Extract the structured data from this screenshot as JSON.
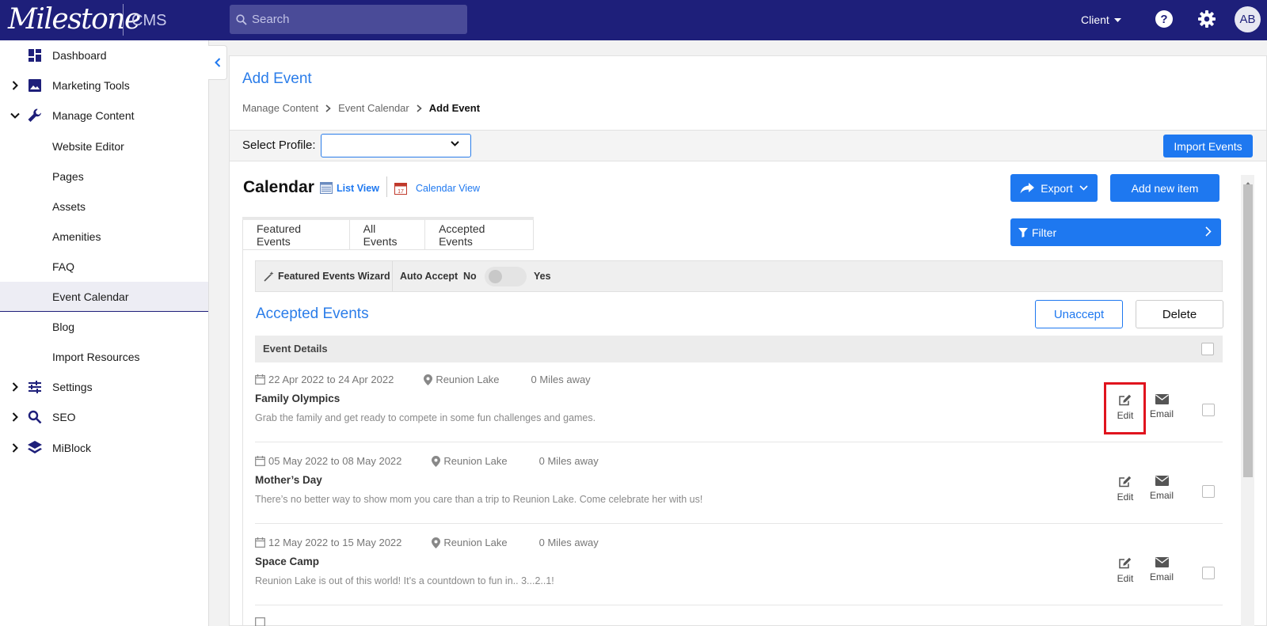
{
  "topbar": {
    "logo_text": "Milestone",
    "product": "CMS",
    "search_placeholder": "Search",
    "client_label": "Client",
    "avatar_initials": "AB",
    "brand_color": "#1e1f7a"
  },
  "sidebar": {
    "items": [
      {
        "label": "Dashboard",
        "icon": "dashboard-icon",
        "expandable": false
      },
      {
        "label": "Marketing Tools",
        "icon": "image-icon",
        "expandable": true
      },
      {
        "label": "Manage Content",
        "icon": "wrench-icon",
        "expandable": true,
        "expanded": true
      },
      {
        "label": "Website Editor"
      },
      {
        "label": "Pages"
      },
      {
        "label": "Assets"
      },
      {
        "label": "Amenities"
      },
      {
        "label": "FAQ"
      },
      {
        "label": "Event Calendar",
        "active": true
      },
      {
        "label": "Blog"
      },
      {
        "label": "Import Resources"
      },
      {
        "label": "Settings",
        "icon": "sliders-icon",
        "expandable": true
      },
      {
        "label": "SEO",
        "icon": "search-icon",
        "expandable": true
      },
      {
        "label": "MiBlock",
        "icon": "layers-icon",
        "expandable": true
      }
    ]
  },
  "page": {
    "title": "Add Event",
    "breadcrumb": [
      "Manage Content",
      "Event Calendar",
      "Add Event"
    ],
    "select_profile_label": "Select Profile:",
    "select_profile_value": "",
    "import_events_label": "Import Events"
  },
  "calendar": {
    "title": "Calendar",
    "list_view_label": "List View",
    "calendar_view_label": "Calendar View",
    "export_label": "Export",
    "add_new_label": "Add new item",
    "filter_label": "Filter",
    "tabs": [
      "Featured Events",
      "All Events",
      "Accepted Events"
    ],
    "wizard_label": "Featured Events Wizard",
    "auto_accept_label": "Auto Accept",
    "auto_accept_no": "No",
    "auto_accept_yes": "Yes",
    "auto_accept_on": false
  },
  "accepted": {
    "title": "Accepted Events",
    "unaccept_label": "Unaccept",
    "delete_label": "Delete",
    "details_header": "Event Details",
    "edit_label": "Edit",
    "email_label": "Email",
    "events": [
      {
        "dates": "22 Apr 2022 to 24 Apr 2022",
        "location": "Reunion Lake",
        "distance": "0 Miles away",
        "name": "Family Olympics",
        "desc": "Grab the family and get ready to compete in some fun challenges and games."
      },
      {
        "dates": "05 May 2022 to 08 May 2022",
        "location": "Reunion Lake",
        "distance": "0 Miles away",
        "name": "Mother’s Day",
        "desc": "There’s no better way to show mom you care than a trip to Reunion Lake. Come celebrate her with us!"
      },
      {
        "dates": "12 May 2022 to 15 May 2022",
        "location": "Reunion Lake",
        "distance": "0 Miles away",
        "name": "Space Camp",
        "desc": "Reunion Lake is out of this world! It’s a countdown to fun in.. 3...2..1!"
      }
    ]
  },
  "colors": {
    "accent": "#1e78f0",
    "highlight": "#e0141e"
  }
}
